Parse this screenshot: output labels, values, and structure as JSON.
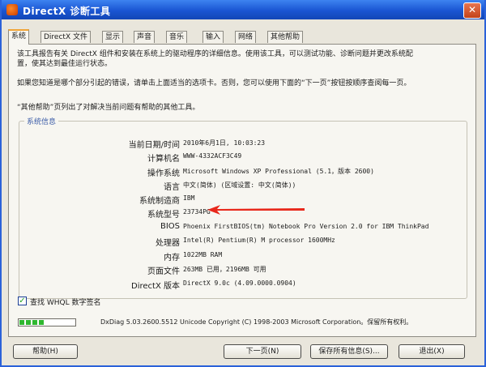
{
  "window": {
    "title": "DirectX 诊断工具",
    "close_glyph": "✕"
  },
  "tabs": [
    {
      "label": "系统",
      "active": true
    },
    {
      "label": "DirectX 文件"
    },
    {
      "label": "显示"
    },
    {
      "label": "声音"
    },
    {
      "label": "音乐"
    },
    {
      "label": "输入"
    },
    {
      "label": "网络"
    },
    {
      "label": "其他帮助"
    }
  ],
  "intro": {
    "p1_line1": "该工具报告有关 DirectX 组件和安装在系统上的驱动程序的详细信息。使用该工具，可以测试功能、诊断问题并更改系统配",
    "p1_line2": "置，使其达到最佳运行状态。",
    "p2": "如果您知道是哪个部分引起的错误，请单击上面适当的选项卡。否则，您可以使用下面的“下一页”按钮按顺序查阅每一页。",
    "p3": "“其他帮助”页列出了对解决当前问题有帮助的其他工具。"
  },
  "system_info": {
    "group_label": "系统信息",
    "rows": [
      {
        "label": "当前日期/时间",
        "value": "2010年6月1日, 10:03:23"
      },
      {
        "label": "计算机名",
        "value": "WWW-4332ACF3C49"
      },
      {
        "label": "操作系统",
        "value": "Microsoft Windows XP Professional (5.1，版本 2600)"
      },
      {
        "label": "语言",
        "value": "中文(简体) (区域设置: 中文(简体))"
      },
      {
        "label": "系统制造商",
        "value": "IBM"
      },
      {
        "label": "系统型号",
        "value": "23734PG"
      },
      {
        "label": "BIOS",
        "value": "Phoenix FirstBIOS(tm) Notebook Pro Version 2.0 for IBM ThinkPad"
      },
      {
        "label": "处理器",
        "value": "Intel(R) Pentium(R) M processor 1600MHz"
      },
      {
        "label": "内存",
        "value": "1022MB RAM"
      },
      {
        "label": "页面文件",
        "value": "263MB 已用，2196MB 可用"
      },
      {
        "label": "DirectX 版本",
        "value": "DirectX 9.0c (4.09.0000.0904)"
      }
    ]
  },
  "whql": {
    "label": "查找 WHQL 数字签名",
    "checked": true,
    "check_glyph": "✓"
  },
  "progress": {
    "fraction": 0.45
  },
  "footer": {
    "text": "DxDiag 5.03.2600.5512 Unicode  Copyright (C) 1998-2003 Microsoft Corporation。保留所有权利。"
  },
  "buttons": {
    "help": "帮助(H)",
    "next": "下一页(N)",
    "save_all": "保存所有信息(S)...",
    "exit": "退出(X)"
  },
  "colors": {
    "titlebar": "#1a55d2",
    "active_tab_highlight": "#f0a436",
    "arrow": "#e8281b"
  }
}
